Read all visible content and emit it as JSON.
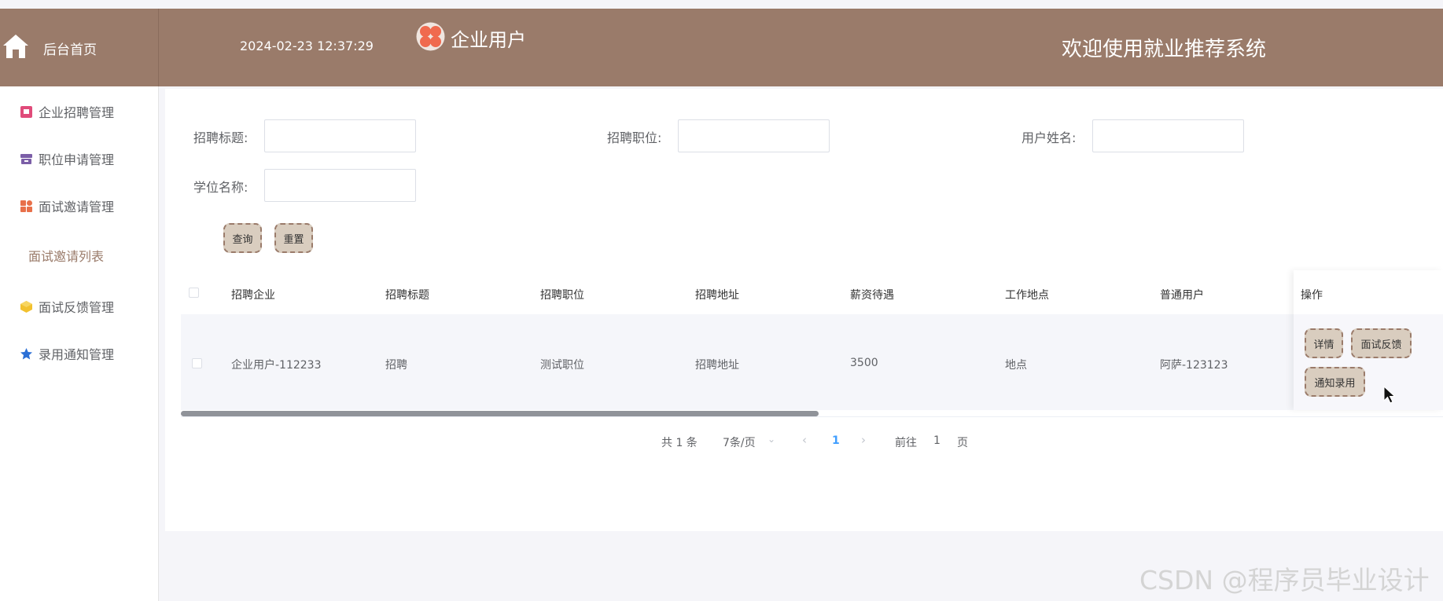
{
  "header": {
    "home_label": "后台首页",
    "datetime": "2024-02-23 12:37:29",
    "user_role": "企业用户",
    "welcome": "欢迎使用就业推荐系统",
    "bar_color": "#9a7b6a"
  },
  "sidebar": {
    "items": [
      {
        "label": "企业招聘管理",
        "icon": "briefcase-icon",
        "color": "#e04b7a"
      },
      {
        "label": "职位申请管理",
        "icon": "archive-icon",
        "color": "#7b5ea7"
      },
      {
        "label": "面试邀请管理",
        "icon": "grid-icon",
        "color": "#e8704a"
      },
      {
        "label": "面试反馈管理",
        "icon": "cube-icon",
        "color": "#f2c12e"
      },
      {
        "label": "录用通知管理",
        "icon": "star-icon",
        "color": "#2b6fd6"
      }
    ],
    "active_sub": "面试邀请列表"
  },
  "search": {
    "fields": [
      {
        "label": "招聘标题:",
        "value": ""
      },
      {
        "label": "招聘职位:",
        "value": ""
      },
      {
        "label": "用户姓名:",
        "value": ""
      },
      {
        "label": "学位名称:",
        "value": ""
      }
    ],
    "query_label": "查询",
    "reset_label": "重置"
  },
  "table": {
    "columns": [
      "招聘企业",
      "招聘标题",
      "招聘职位",
      "招聘地址",
      "薪资待遇",
      "工作地点",
      "普通用户",
      "操作"
    ],
    "rows": [
      {
        "cells": [
          "企业用户-112233",
          "招聘",
          "测试职位",
          "招聘地址",
          "3500",
          "地点",
          "阿萨-123123"
        ]
      }
    ],
    "actions": {
      "detail": "详情",
      "feedback": "面试反馈",
      "notify": "通知录用"
    }
  },
  "pagination": {
    "total": "共 1 条",
    "page_size": "7条/页",
    "current_page": "1",
    "goto_prefix": "前往",
    "goto_value": "1",
    "goto_suffix": "页"
  },
  "watermark": "CSDN @程序员毕业设计"
}
